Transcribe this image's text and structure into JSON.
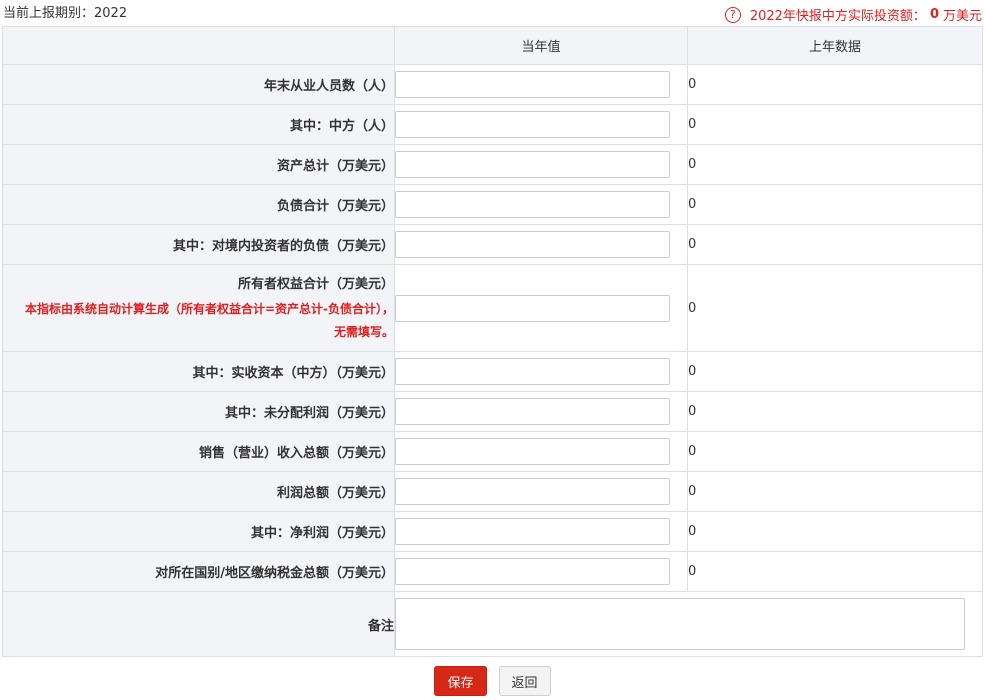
{
  "header": {
    "period_label": "当前上报期别：2022",
    "notice_prefix": "2022年快报中方实际投资额：",
    "notice_amount": "0",
    "notice_unit": "万美元"
  },
  "table": {
    "col_current": "当年值",
    "col_previous": "上年数据",
    "rows": [
      {
        "label": "年末从业人员数（人）",
        "value": "",
        "previous": "0"
      },
      {
        "label": "其中：中方（人）",
        "value": "",
        "previous": "0"
      },
      {
        "label": "资产总计（万美元）",
        "value": "",
        "previous": "0"
      },
      {
        "label": "负债合计（万美元）",
        "value": "",
        "previous": "0"
      },
      {
        "label": "其中：对境内投资者的负债（万美元）",
        "value": "",
        "previous": "0"
      },
      {
        "label": "所有者权益合计（万美元）",
        "hint_line1": "本指标由系统自动计算生成（所有者权益合计=资产总计-负债合计），",
        "hint_line2": "无需填写。",
        "value": "",
        "previous": "0"
      },
      {
        "label": "其中：实收资本（中方）（万美元）",
        "value": "",
        "previous": "0"
      },
      {
        "label": "其中：未分配利润（万美元）",
        "value": "",
        "previous": "0"
      },
      {
        "label": "销售（营业）收入总额（万美元）",
        "value": "",
        "previous": "0"
      },
      {
        "label": "利润总额（万美元）",
        "value": "",
        "previous": "0"
      },
      {
        "label": "其中：净利润（万美元）",
        "value": "",
        "previous": "0"
      },
      {
        "label": "对所在国别/地区缴纳税金总额（万美元）",
        "value": "",
        "previous": "0"
      }
    ],
    "remark_label": "备注",
    "remark_value": ""
  },
  "actions": {
    "save_label": "保存",
    "back_label": "返回"
  },
  "colors": {
    "accent_red": "#d52817",
    "header_bg": "#f2f4f7",
    "border": "#dcdfe3"
  }
}
